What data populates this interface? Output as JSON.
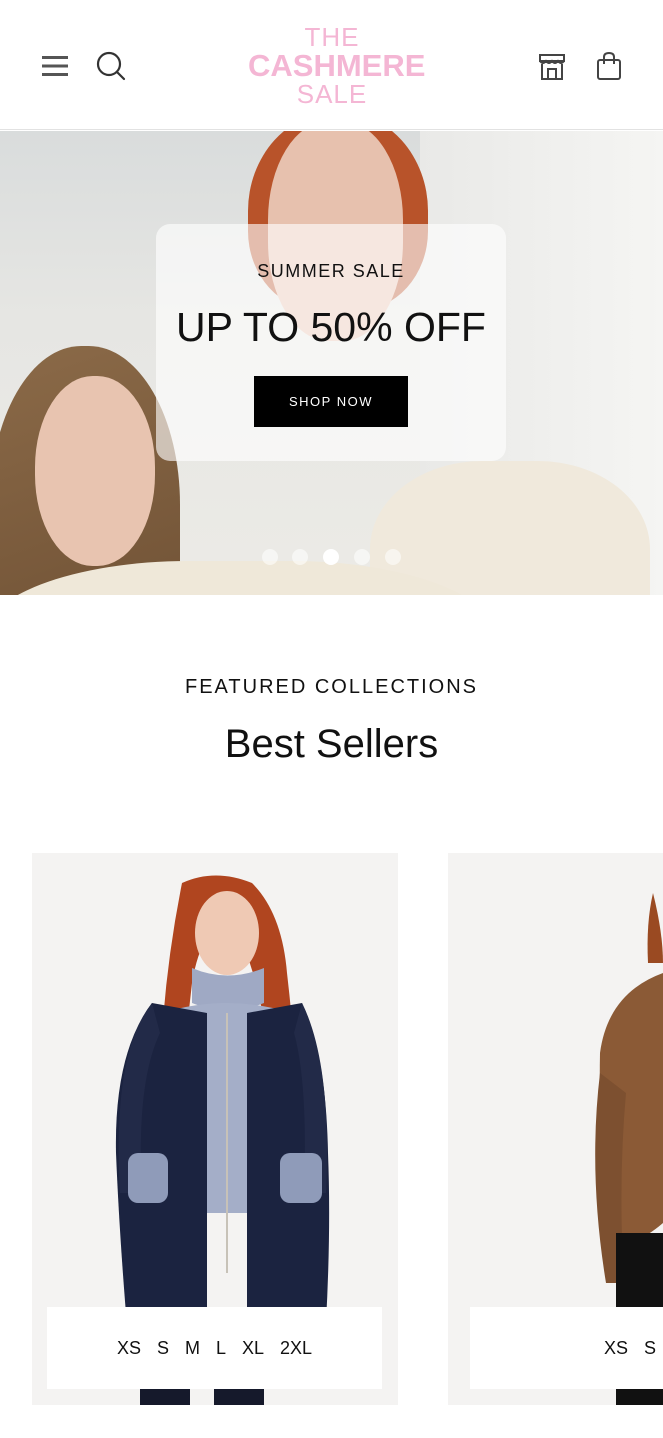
{
  "header": {
    "logo_line1": "THE",
    "logo_line2": "CASHMERE",
    "logo_line3": "SALE",
    "icons": [
      "menu-icon",
      "search-icon",
      "store-icon",
      "shopping-bag-icon"
    ]
  },
  "hero": {
    "eyebrow": "SUMMER SALE",
    "headline": "UP TO 50% OFF",
    "cta": "SHOP NOW",
    "slides_count": 5,
    "active_slide": 3
  },
  "section": {
    "eyebrow": "FEATURED COLLECTIONS",
    "title": "Best Sellers"
  },
  "products": [
    {
      "sizes": [
        "XS",
        "S",
        "M",
        "L",
        "XL",
        "2XL"
      ]
    },
    {
      "sizes": [
        "XS",
        "S"
      ]
    }
  ],
  "colors": {
    "logo": "#f4b6d4",
    "cta_bg": "#000000",
    "card_bg": "#f4f3f2"
  }
}
